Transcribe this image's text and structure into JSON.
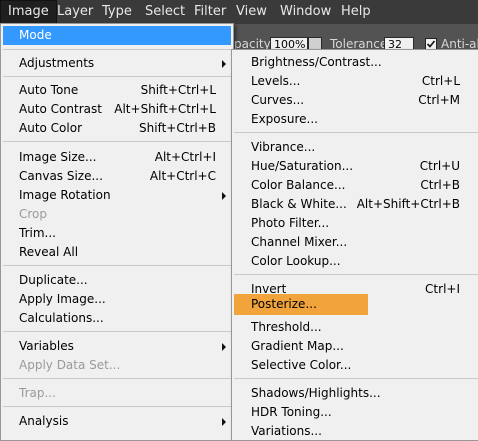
{
  "menubar": {
    "items": [
      "Image",
      "Layer",
      "Type",
      "Select",
      "Filter",
      "View",
      "Window",
      "Help"
    ]
  },
  "options_bar": {
    "opacity_label": "pacity:",
    "opacity_value": "100%",
    "tolerance_label": "Tolerance:",
    "tolerance_value": "32",
    "antialias_label": "Anti-alia"
  },
  "image_menu": {
    "mode": "Mode",
    "adjustments": "Adjustments",
    "auto_tone": "Auto Tone",
    "auto_tone_sc": "Shift+Ctrl+L",
    "auto_contrast": "Auto Contrast",
    "auto_contrast_sc": "Alt+Shift+Ctrl+L",
    "auto_color": "Auto Color",
    "auto_color_sc": "Shift+Ctrl+B",
    "image_size": "Image Size...",
    "image_size_sc": "Alt+Ctrl+I",
    "canvas_size": "Canvas Size...",
    "canvas_size_sc": "Alt+Ctrl+C",
    "image_rotation": "Image Rotation",
    "crop": "Crop",
    "trim": "Trim...",
    "reveal_all": "Reveal All",
    "duplicate": "Duplicate...",
    "apply_image": "Apply Image...",
    "calculations": "Calculations...",
    "variables": "Variables",
    "apply_data_set": "Apply Data Set...",
    "trap": "Trap...",
    "analysis": "Analysis"
  },
  "adjust_menu": {
    "brightness_contrast": "Brightness/Contrast...",
    "levels": "Levels...",
    "levels_sc": "Ctrl+L",
    "curves": "Curves...",
    "curves_sc": "Ctrl+M",
    "exposure": "Exposure...",
    "vibrance": "Vibrance...",
    "hue_saturation": "Hue/Saturation...",
    "hue_saturation_sc": "Ctrl+U",
    "color_balance": "Color Balance...",
    "color_balance_sc": "Ctrl+B",
    "black_white": "Black & White...",
    "black_white_sc": "Alt+Shift+Ctrl+B",
    "photo_filter": "Photo Filter...",
    "channel_mixer": "Channel Mixer...",
    "color_lookup": "Color Lookup...",
    "invert": "Invert",
    "invert_sc": "Ctrl+I",
    "posterize": "Posterize...",
    "threshold": "Threshold...",
    "gradient_map": "Gradient Map...",
    "selective_color": "Selective Color...",
    "shadows_highlights": "Shadows/Highlights...",
    "hdr_toning": "HDR Toning...",
    "variations": "Variations..."
  },
  "colors": {
    "highlight_blue": "#3399ff",
    "highlight_orange": "#f1a43c",
    "menubar_bg": "#3a3a3a",
    "menu_bg": "#f0f0f0"
  }
}
